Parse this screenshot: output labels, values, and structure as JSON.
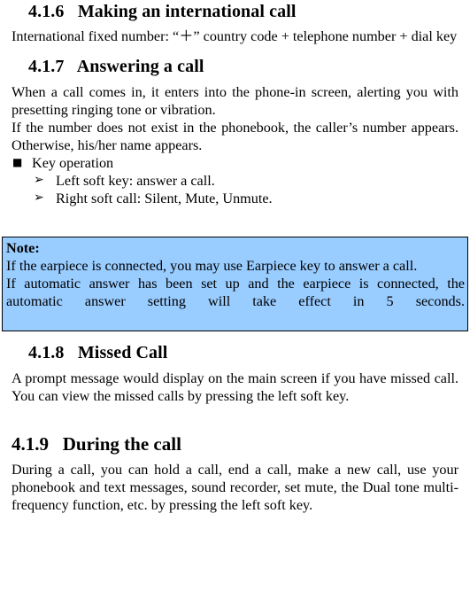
{
  "document": {
    "sections": [
      {
        "number": "4.1.6",
        "title": "Making an international call",
        "paragraphs": [
          "International fixed number: “＋” country code + telephone number + dial key"
        ]
      },
      {
        "number": "4.1.7",
        "title": "Answering a call",
        "paragraphs": [
          "When a call comes in, it enters into the phone-in screen, alerting you with presetting ringing tone or vibration.",
          "If the number does not exist in the phonebook, the caller’s number appears. Otherwise, his/her name appears."
        ],
        "bullet_square": "Key operation",
        "sub_bullets": [
          "Left soft key: answer a call.",
          "Right soft call: Silent, Mute, Unmute."
        ]
      },
      {
        "number": "4.1.8",
        "title": "Missed Call",
        "paragraphs": [
          "A prompt message would display on the main screen if you have missed call. You can view the missed calls by pressing the left soft key."
        ]
      },
      {
        "number": "4.1.9",
        "title": "During the call",
        "paragraphs": [
          "During a call, you can hold a call, end a call, make a new call, use your phonebook and text messages, sound recorder, set mute, the Dual tone multi-frequency function, etc. by pressing the left soft key."
        ]
      }
    ],
    "note": {
      "label": "Note:",
      "lines": [
        "If the earpiece is connected, you may use Earpiece key to answer a call.",
        "If automatic answer has been set up and the earpiece is connected, the automatic answer setting will take effect in 5 seconds."
      ],
      "background_color": "#99CCFF",
      "border_color": "#000000"
    },
    "markers": {
      "square_bullet": "■",
      "arrow_bullet": "➢"
    }
  }
}
